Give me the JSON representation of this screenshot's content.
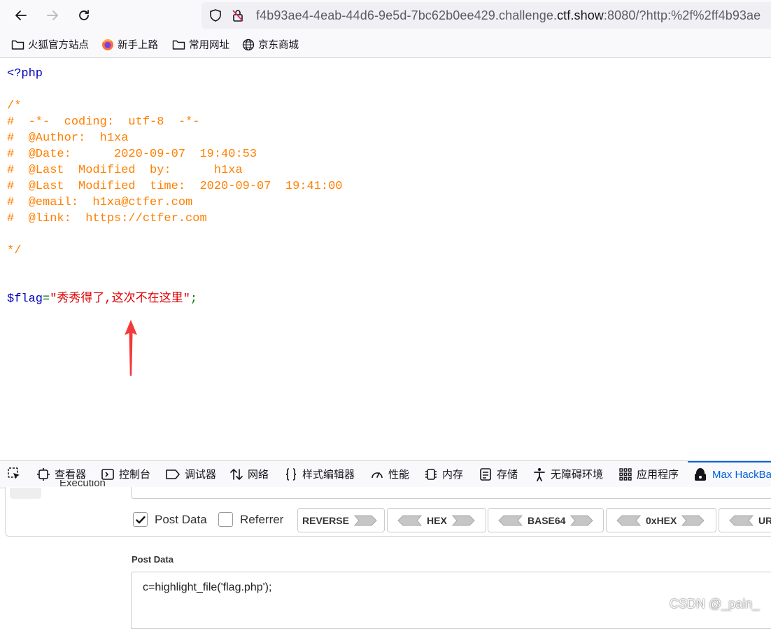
{
  "browser": {
    "url_prefix": "f4b93ae4-4eab-44d6-9e5d-7bc62b0ee429.challenge.",
    "url_host": "ctf.show",
    "url_suffix": ":8080/?http:%2f%2ff4b93ae",
    "bookmarks": [
      "火狐官方站点",
      "新手上路",
      "常用网址",
      "京东商城"
    ]
  },
  "code": {
    "php_open": "<?php",
    "comment_open": "/*",
    "comment_lines": [
      "#  -*-  coding:  utf-8  -*-",
      "#  @Author:  h1xa",
      "#  @Date:      2020-09-07  19:40:53",
      "#  @Last  Modified  by:      h1xa",
      "#  @Last  Modified  time:  2020-09-07  19:41:00",
      "#  @email:  h1xa@ctfer.com",
      "#  @link:  https://ctfer.com"
    ],
    "comment_close": "*/",
    "var_name": "$flag",
    "assign": "=",
    "string_value": "\"秀秀得了,这次不在这里\"",
    "semicolon": ";"
  },
  "devtools": {
    "tabs": [
      "查看器",
      "控制台",
      "调试器",
      "网络",
      "样式编辑器",
      "性能",
      "内存",
      "存储",
      "无障碍环境",
      "应用程序",
      "Max HackBa"
    ]
  },
  "hackbar": {
    "execution_label": "Execution",
    "post_data_checkbox": "Post Data",
    "post_data_checked": true,
    "referrer_checkbox": "Referrer",
    "referrer_checked": false,
    "buttons": [
      "REVERSE",
      "HEX",
      "BASE64",
      "0xHEX",
      "UR"
    ],
    "post_data_label": "Post Data",
    "post_data_value": "c=highlight_file('flag.php');"
  },
  "watermark": "CSDN @_pain_"
}
